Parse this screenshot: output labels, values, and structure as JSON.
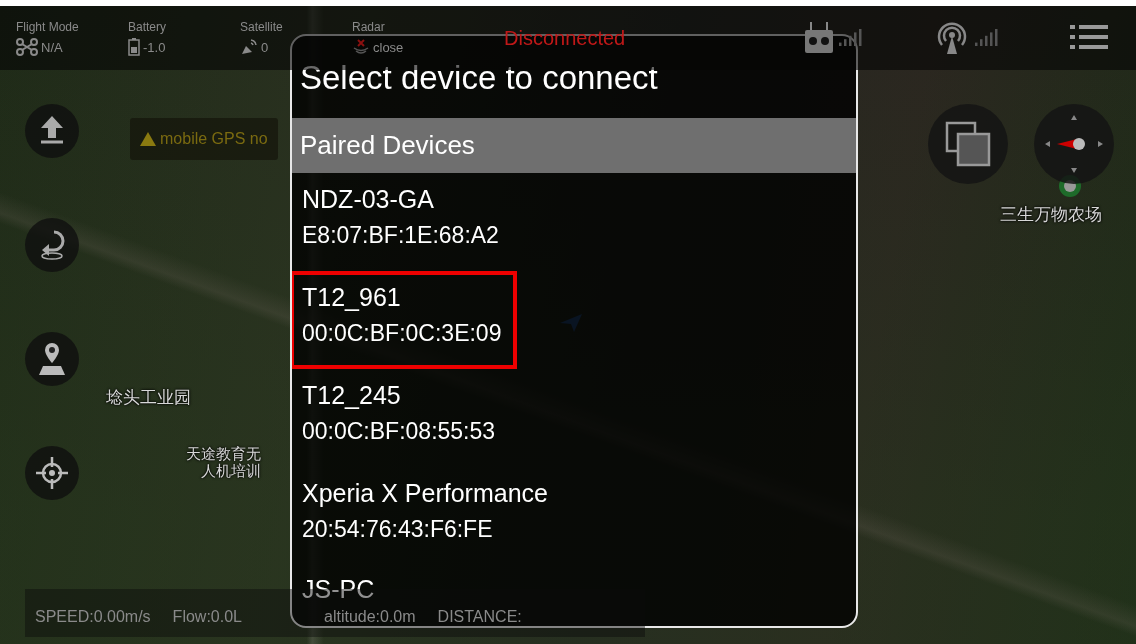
{
  "status_bar": {
    "items": [
      {
        "kind": "flight_mode",
        "label": "Flight Mode",
        "value": "N/A"
      },
      {
        "kind": "battery",
        "label": "Battery",
        "value": "-1.0"
      },
      {
        "kind": "satellite",
        "label": "Satellite",
        "value": "0"
      },
      {
        "kind": "radar",
        "label": "Radar",
        "value": "close"
      }
    ],
    "connection": "Disconnected"
  },
  "warning": "mobile GPS no",
  "map_labels": [
    {
      "text": "埝头工业园",
      "kind": "plain"
    },
    {
      "text": "天途教育无人机培训",
      "kind": "wrapped"
    },
    {
      "text": "三生万物农场",
      "kind": "plain"
    }
  ],
  "telemetry": [
    "SPEED:0.00m/s",
    "Flow:0.0L",
    "altitude:0.0m",
    "DISTANCE:"
  ],
  "dialog": {
    "title": "Select device to connect",
    "section": "Paired Devices",
    "devices": [
      {
        "name": "NDZ-03-GA",
        "address": "E8:07:BF:1E:68:A2",
        "highlighted": false
      },
      {
        "name": "T12_961",
        "address": "00:0C:BF:0C:3E:09",
        "highlighted": true
      },
      {
        "name": "T12_245",
        "address": "00:0C:BF:08:55:53",
        "highlighted": false
      },
      {
        "name": "Xperia X Performance",
        "address": "20:54:76:43:F6:FE",
        "highlighted": false
      },
      {
        "name": "JS-PC",
        "highlighted": false
      }
    ]
  }
}
